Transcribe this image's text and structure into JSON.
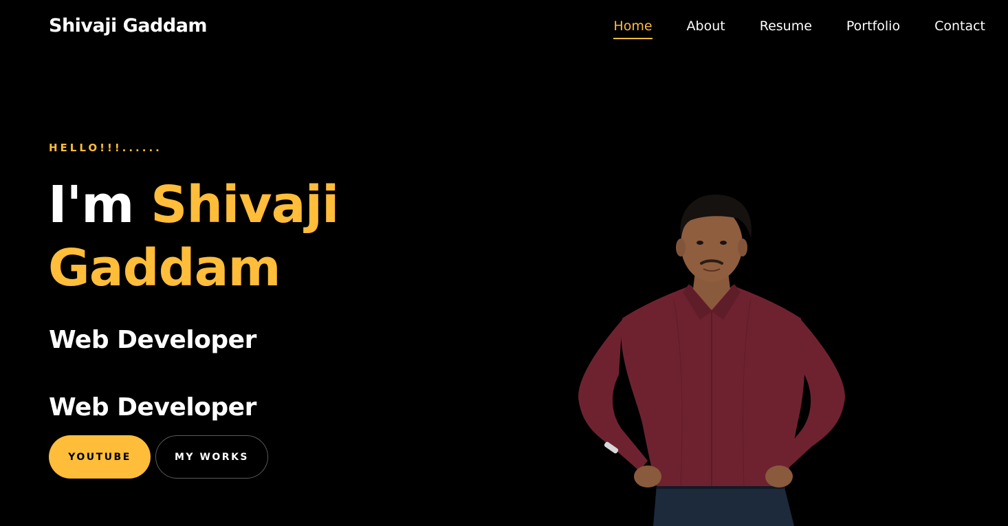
{
  "header": {
    "brand": "Shivaji Gaddam",
    "nav": [
      {
        "label": "Home",
        "active": true
      },
      {
        "label": "About",
        "active": false
      },
      {
        "label": "Resume",
        "active": false
      },
      {
        "label": "Portfolio",
        "active": false
      },
      {
        "label": "Contact",
        "active": false
      }
    ]
  },
  "hero": {
    "greeting": "HELLO!!!......",
    "title_prefix": "I'm ",
    "title_name": "Shivaji Gaddam",
    "roles": [
      "Web Developer",
      "Web Developer"
    ],
    "buttons": {
      "primary": "YOUTUBE",
      "secondary": "MY WORKS"
    }
  },
  "colors": {
    "background": "#000000",
    "accent": "#ffbd39",
    "text": "#ffffff",
    "shirt": "#6e2230",
    "jeans": "#1c2a3c"
  },
  "icons": {
    "portrait": "person-photo"
  }
}
